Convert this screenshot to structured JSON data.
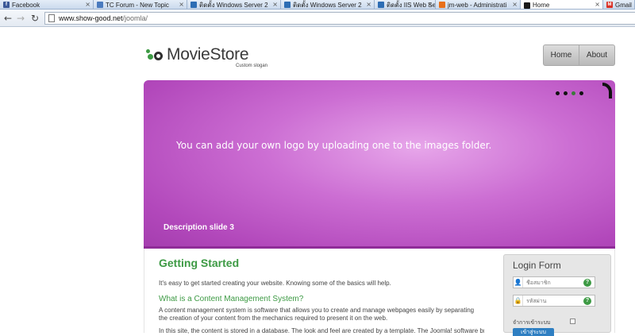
{
  "browser": {
    "tabs": [
      {
        "label": "Facebook",
        "icon": "facebook-icon",
        "color": "#3b5998",
        "glyph": "f"
      },
      {
        "label": "TC Forum - New Topic",
        "icon": "forum-icon",
        "color": "#4a7bbf",
        "glyph": ""
      },
      {
        "label": "ติดตั้ง Windows Server 2",
        "icon": "site-icon",
        "color": "#2d6db4",
        "glyph": ""
      },
      {
        "label": "ติดตั้ง Windows Server 2",
        "icon": "site-icon",
        "color": "#2d6db4",
        "glyph": ""
      },
      {
        "label": "ติดตั้ง IIS Web Server แต่",
        "icon": "site-icon",
        "color": "#2d6db4",
        "glyph": ""
      },
      {
        "label": "jm-web - Administrati",
        "icon": "joomla-icon",
        "color": "#e8701a",
        "glyph": ""
      },
      {
        "label": "Home",
        "icon": "joomla-icon",
        "color": "#1a1a1a",
        "glyph": ""
      },
      {
        "label": "Gmail",
        "icon": "gmail-icon",
        "color": "#d93025",
        "glyph": "M"
      }
    ],
    "active_tab": 6,
    "close_glyph": "×",
    "back_glyph": "←",
    "forward_glyph": "→",
    "reload_glyph": "↻",
    "url_host": "www.show-good.net",
    "url_path": "/joomla/"
  },
  "site": {
    "logo_text": "MovieStore",
    "slogan": "Custom slogan",
    "nav": [
      "Home",
      "About"
    ],
    "colors": {
      "green": "#3d9a44",
      "blue": "#2f7fc2",
      "purple": "#b248bb"
    }
  },
  "slideshow": {
    "caption": "You can add your own logo by uploading one to the images folder.",
    "description": "Description slide 3",
    "dot_count": 4,
    "current_dot": 2
  },
  "article": {
    "title": "Getting Started",
    "intro": "It's easy to get started creating your website. Knowing some of the basics will help.",
    "subtitle": "What is a Content Management System?",
    "body": "A content management system is software that allows you to create and manage webpages easily by separating the creation of your content from the mechanics required to present it on the web.",
    "more": "In this site, the content is stored in a database. The look and feel are created by a template. The Joomla! software brings"
  },
  "login": {
    "title": "Login Form",
    "username_placeholder": "ชื่อสมาชิก",
    "password_placeholder": "รหัสผ่าน",
    "user_glyph": "👤",
    "lock_glyph": "🔒",
    "help_glyph": "?",
    "remember_label": "จำการเข้าระบบ",
    "button_label": "เข้าสู่ระบบ"
  }
}
